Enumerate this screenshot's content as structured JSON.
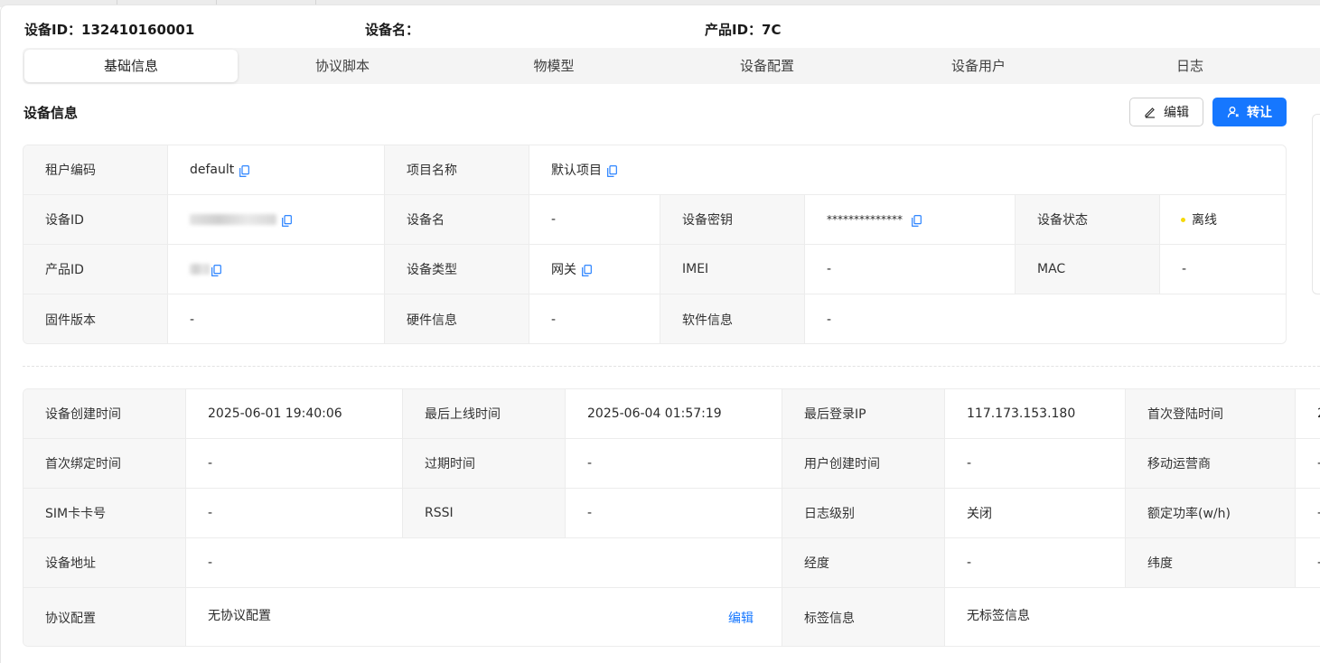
{
  "header": {
    "device_id_label": "设备ID：",
    "device_id_value": "132410160001",
    "device_name_label": "设备名：",
    "device_name_value": "",
    "product_id_label": "产品ID：",
    "product_id_value": "7C"
  },
  "tabs": [
    {
      "label": "基础信息",
      "active": true
    },
    {
      "label": "协议脚本",
      "active": false
    },
    {
      "label": "物模型",
      "active": false
    },
    {
      "label": "设备配置",
      "active": false
    },
    {
      "label": "设备用户",
      "active": false
    },
    {
      "label": "日志",
      "active": false
    }
  ],
  "section": {
    "title": "设备信息",
    "edit_label": "编辑",
    "transfer_label": "转让"
  },
  "device_info": {
    "tenant_code_label": "租户编码",
    "tenant_code_value": "default",
    "project_name_label": "项目名称",
    "project_name_value": "默认项目",
    "device_id_label": "设备ID",
    "device_name_label": "设备名",
    "device_name_value": "-",
    "device_secret_label": "设备密钥",
    "device_secret_value": "**************",
    "device_status_label": "设备状态",
    "device_status_value": "离线",
    "product_id_label": "产品ID",
    "device_type_label": "设备类型",
    "device_type_value": "网关",
    "imei_label": "IMEI",
    "imei_value": "-",
    "mac_label": "MAC",
    "mac_value": "-",
    "firmware_label": "固件版本",
    "firmware_value": "-",
    "hardware_label": "硬件信息",
    "hardware_value": "-",
    "software_label": "软件信息",
    "software_value": "-"
  },
  "extra_info": {
    "created_label": "设备创建时间",
    "created_value": "2025-06-01 19:40:06",
    "last_online_label": "最后上线时间",
    "last_online_value": "2025-06-04 01:57:19",
    "last_ip_label": "最后登录IP",
    "last_ip_value": "117.173.153.180",
    "first_login_label": "首次登陆时间",
    "first_login_value": "2",
    "first_bind_label": "首次绑定时间",
    "first_bind_value": "-",
    "expire_label": "过期时间",
    "expire_value": "-",
    "user_created_label": "用户创建时间",
    "user_created_value": "-",
    "carrier_label": "移动运营商",
    "carrier_value": "-",
    "sim_label": "SIM卡卡号",
    "sim_value": "-",
    "rssi_label": "RSSI",
    "rssi_value": "-",
    "log_level_label": "日志级别",
    "log_level_value": "关闭",
    "power_label": "额定功率(w/h)",
    "power_value": "-",
    "address_label": "设备地址",
    "address_value": "-",
    "longitude_label": "经度",
    "longitude_value": "-",
    "latitude_label": "纬度",
    "latitude_value": "-",
    "protocol_label": "协议配置",
    "protocol_value": "无协议配置",
    "protocol_edit": "编辑",
    "tags_label": "标签信息",
    "tags_value": "无标签信息"
  },
  "colors": {
    "primary": "#1677ff",
    "status_offline_dot": "#f5d90a",
    "label_bg": "#f7f7f7",
    "border": "#ececec"
  }
}
